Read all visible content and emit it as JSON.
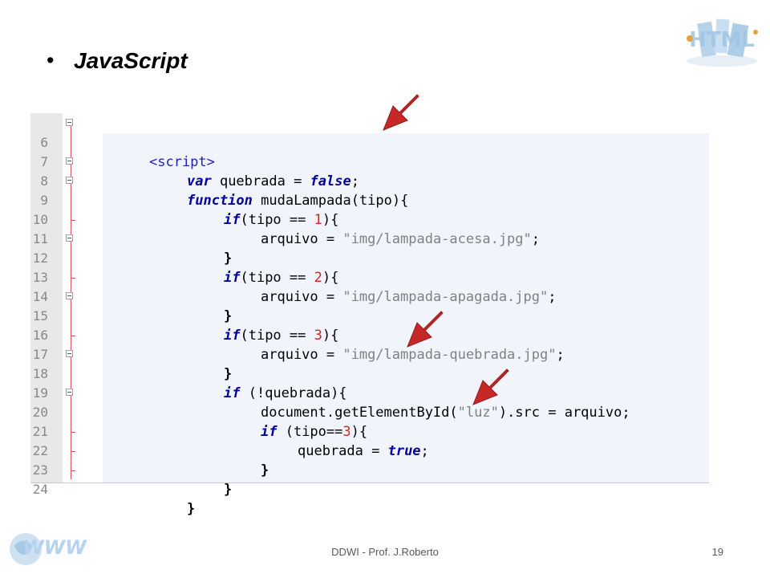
{
  "slide": {
    "bullet": "•",
    "title": "JavaScript"
  },
  "code": {
    "lines": [
      {
        "n": "6",
        "text": "<script>"
      },
      {
        "n": "7",
        "text": "var quebrada = false;"
      },
      {
        "n": "8",
        "text": "function mudaLampada(tipo){"
      },
      {
        "n": "9",
        "text": "if(tipo == 1){"
      },
      {
        "n": "10",
        "text": "arquivo = \"img/lampada-acesa.jpg\";"
      },
      {
        "n": "11",
        "text": "}"
      },
      {
        "n": "12",
        "text": "if(tipo == 2){"
      },
      {
        "n": "13",
        "text": "arquivo = \"img/lampada-apagada.jpg\";"
      },
      {
        "n": "14",
        "text": "}"
      },
      {
        "n": "15",
        "text": "if(tipo == 3){"
      },
      {
        "n": "16",
        "text": "arquivo = \"img/lampada-quebrada.jpg\";"
      },
      {
        "n": "17",
        "text": "}"
      },
      {
        "n": "18",
        "text": "if (!quebrada){"
      },
      {
        "n": "19",
        "text": "document.getElementById(\"luz\").src = arquivo;"
      },
      {
        "n": "20",
        "text": "if (tipo==3){"
      },
      {
        "n": "21",
        "text": "quebrada = true;"
      },
      {
        "n": "22",
        "text": "}"
      },
      {
        "n": "23",
        "text": "}"
      },
      {
        "n": "24",
        "text": "}"
      }
    ]
  },
  "footer": {
    "text": "DDWI - Prof. J.Roberto",
    "page": "19"
  },
  "logos": {
    "top": "HTML",
    "bottom": "WWW"
  },
  "colors": {
    "keyword": "#0000a0",
    "string": "#808080",
    "number": "#e02020",
    "arrow": "#c62828"
  }
}
